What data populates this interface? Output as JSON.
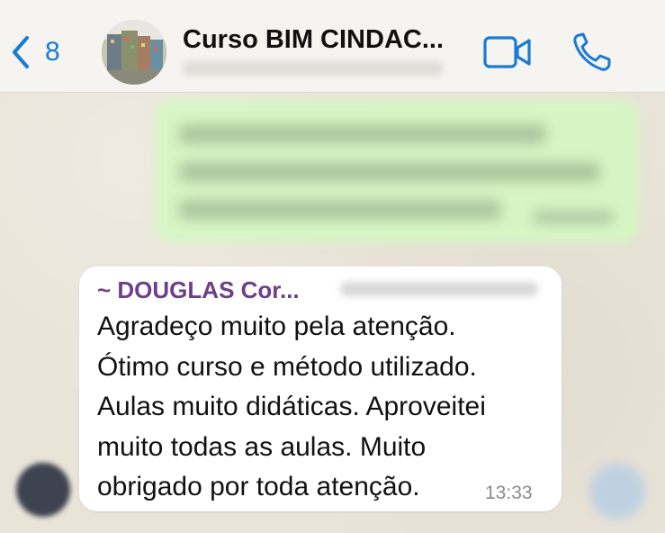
{
  "header": {
    "back_count": "8",
    "title": "Curso BIM CINDAC...",
    "icons": {
      "back": "chevron-left-icon",
      "video": "video-camera-icon",
      "call": "phone-icon"
    },
    "accent_color": "#1a7bd4"
  },
  "message": {
    "sender": "~ DOUGLAS Cor...",
    "text": "Agradeço muito pela atenção.\nÓtimo curso e método utilizado.\nAulas muito didáticas. Aproveitei\nmuito todas as aulas. Muito\nobrigado por toda atenção.",
    "time": "13:33",
    "sender_color": "#6e3f86"
  },
  "colors": {
    "outgoing_bubble": "#d6f5c4",
    "incoming_bubble": "#ffffff",
    "chat_background": "#e9e3d8"
  }
}
